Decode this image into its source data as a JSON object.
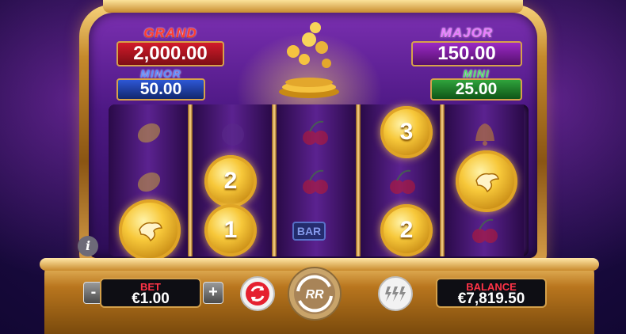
{
  "jackpots": {
    "grand": {
      "title": "GRAND",
      "value": "2,000.00"
    },
    "major": {
      "title": "MAJOR",
      "value": "150.00"
    },
    "minor": {
      "title": "MINOR",
      "value": "50.00"
    },
    "mini": {
      "title": "MINI",
      "value": "25.00"
    }
  },
  "coins": [
    {
      "name": "coin-reel1-eagle",
      "label": "",
      "icon": "eagle-icon"
    },
    {
      "name": "coin-reel2-top",
      "label": "2"
    },
    {
      "name": "coin-reel2-bottom",
      "label": "1"
    },
    {
      "name": "coin-reel4-top",
      "label": "3"
    },
    {
      "name": "coin-reel4-bottom",
      "label": "2"
    },
    {
      "name": "coin-reel5-eagle",
      "label": "",
      "icon": "eagle-icon"
    }
  ],
  "symbols": {
    "bar": "BAR"
  },
  "controls": {
    "info": "i",
    "bet_label": "BET",
    "bet_value": "€1.00",
    "minus": "-",
    "plus": "+",
    "spin_label": "RR",
    "balance_label": "BALANCE",
    "balance_value": "€7,819.50"
  },
  "colors": {
    "grand": "#d21b2a",
    "major": "#9b2ac5",
    "minor": "#2d57d6",
    "mini": "#2fa33c",
    "gold": "#f7c83a"
  }
}
